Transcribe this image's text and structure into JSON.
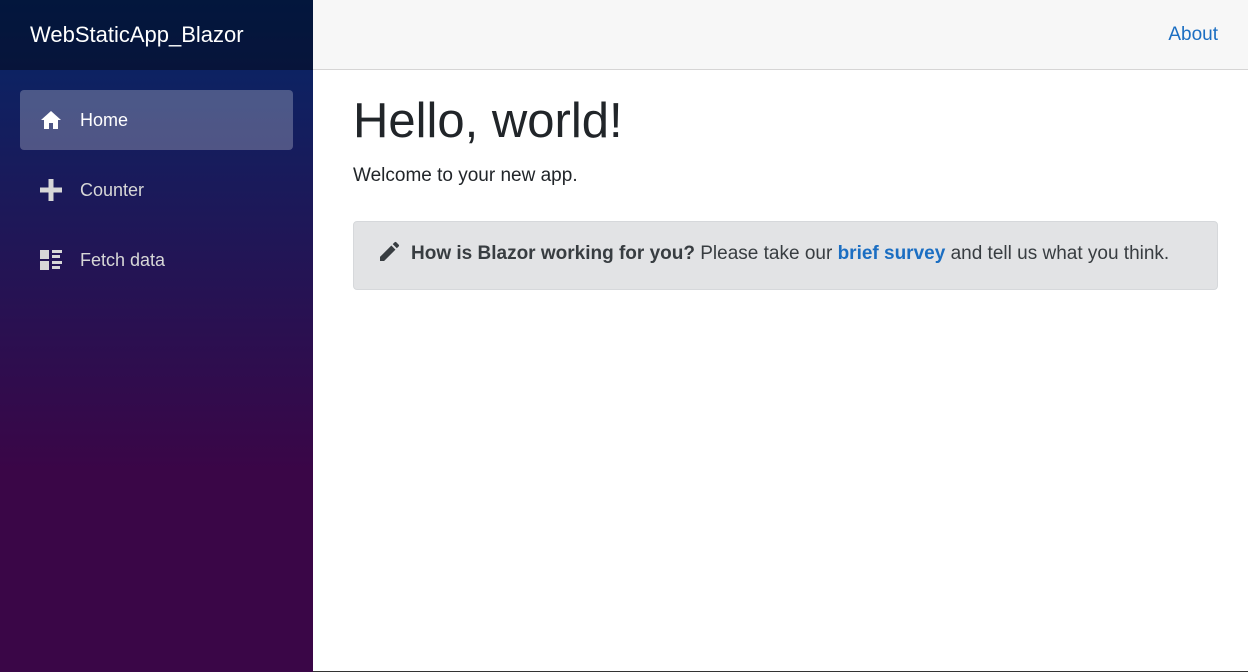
{
  "brand": {
    "title": "WebStaticApp_Blazor"
  },
  "sidebar": {
    "items": [
      {
        "label": "Home",
        "icon": "home-icon",
        "active": true
      },
      {
        "label": "Counter",
        "icon": "plus-icon",
        "active": false
      },
      {
        "label": "Fetch data",
        "icon": "list-rich-icon",
        "active": false
      }
    ]
  },
  "topbar": {
    "about_label": "About"
  },
  "main": {
    "title": "Hello, world!",
    "welcome": "Welcome to your new app.",
    "survey": {
      "icon": "pencil-icon",
      "question": "How is Blazor working for you?",
      "text_before": " Please take our ",
      "link_label": "brief survey",
      "text_after": " and tell us what you think."
    }
  },
  "colors": {
    "sidebar_top": "#052767",
    "sidebar_bottom": "#3a0647",
    "link": "#1b6ec2",
    "alert_bg": "#e2e3e5"
  }
}
